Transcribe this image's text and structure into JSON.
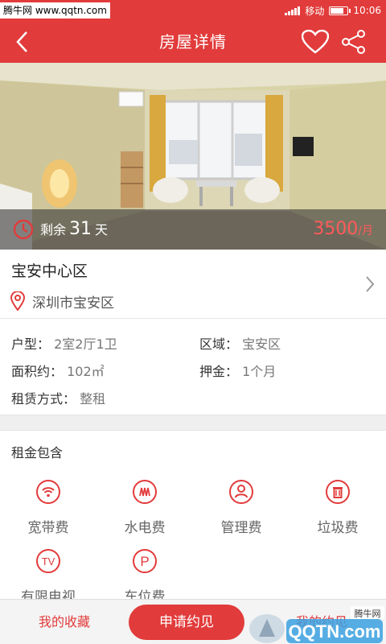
{
  "watermark": "腾牛网 www.qqtn.com",
  "status": {
    "carrier": "移动",
    "time": "10:06"
  },
  "header": {
    "title": "房屋详情"
  },
  "photo": {
    "remain_prefix": "剩余",
    "remain_days": "31",
    "remain_suffix": "天",
    "price": "3500",
    "price_unit": "/月"
  },
  "community": {
    "name": "宝安中心区",
    "district": "深圳市宝安区"
  },
  "info": {
    "layout_label": "户型：",
    "layout_value": "2室2厅1卫",
    "area_label": "区域：",
    "area_value": "宝安区",
    "size_label": "面积约：",
    "size_value": "102㎡",
    "deposit_label": "押金：",
    "deposit_value": "1个月",
    "rent_label": "租赁方式：",
    "rent_value": "整租"
  },
  "fees": {
    "title": "租金包含",
    "items": [
      {
        "label": "宽带费",
        "icon": "wifi-icon"
      },
      {
        "label": "水电费",
        "icon": "utilities-icon"
      },
      {
        "label": "管理费",
        "icon": "management-icon"
      },
      {
        "label": "垃圾费",
        "icon": "trash-icon"
      },
      {
        "label": "有限电视",
        "icon": "tv-icon"
      },
      {
        "label": "车位费",
        "icon": "parking-icon"
      }
    ]
  },
  "bottom": {
    "favorites": "我的收藏",
    "apply": "申请约见",
    "appointments": "我的约见"
  },
  "colors": {
    "accent": "#e23b3b"
  },
  "logo_watermark": {
    "text": "QQTN.com",
    "tag": "腾牛网"
  }
}
